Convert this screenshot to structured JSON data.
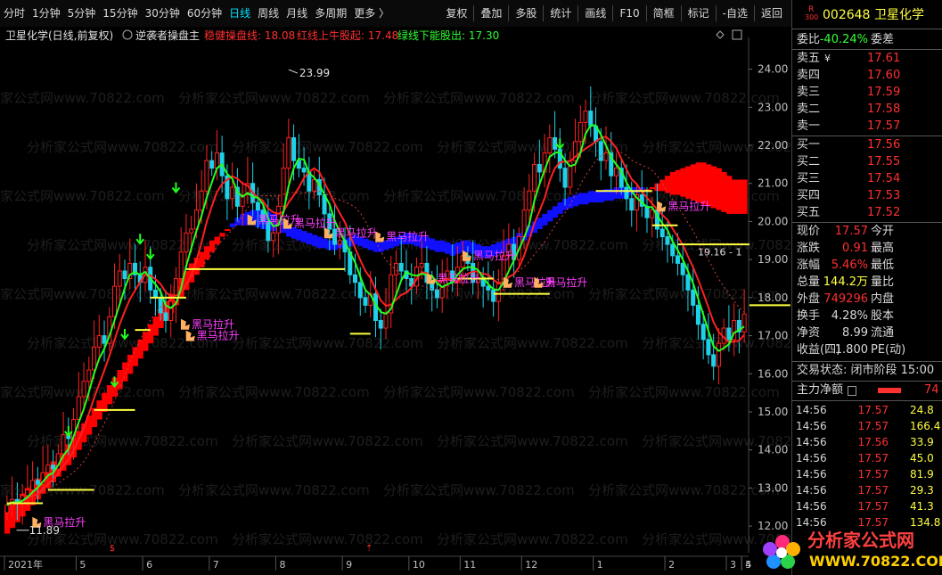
{
  "toolbar": {
    "left": [
      "分时",
      "1分钟",
      "5分钟",
      "15分钟",
      "30分钟",
      "60分钟",
      "日线",
      "周线",
      "月线",
      "多周期",
      "更多 〉"
    ],
    "active_index": 6,
    "right": [
      "复权",
      "叠加",
      "多股",
      "统计",
      "画线",
      "F10",
      "简框",
      "标记",
      "-自选",
      "返回"
    ]
  },
  "header": {
    "name": "卫星化学(日线,前复权)",
    "indicator": "逆袭者操盘主",
    "l1": "稳健操盘线: 18.08",
    "l2": "红线上牛股起: 17.48",
    "l3": "绿线下能股出: 17.30"
  },
  "chart_data": {
    "type": "candlestick",
    "ylim": [
      11.3,
      24.6
    ],
    "yticks": [
      "24.00",
      "23.00",
      "22.00",
      "21.00",
      "20.00",
      "19.00",
      "18.00",
      "17.00",
      "16.00",
      "15.00",
      "14.00",
      "13.00",
      "12.00"
    ],
    "xticks": [
      "2021年",
      "5",
      "6",
      "7",
      "8",
      "9",
      "10",
      "11",
      "12",
      "1",
      "2",
      "3",
      "4",
      "5"
    ],
    "annotations": {
      "high": "23.99",
      "low": "11.89",
      "right_price": "19.16 - 1"
    },
    "signal_label": "黑马拉升",
    "watermark": "分析家公式网www.70822.com",
    "close": [
      12.55,
      12.7,
      12.6,
      12.8,
      12.95,
      13.2,
      13.1,
      13.4,
      13.6,
      13.5,
      13.9,
      14.4,
      14.3,
      14.8,
      15.4,
      15.8,
      16.1,
      16.7,
      17.0,
      16.8,
      17.5,
      18.3,
      18.7,
      18.5,
      18.9,
      18.6,
      18.4,
      18.8,
      18.2,
      18.0,
      17.6,
      17.4,
      17.9,
      18.5,
      19.2,
      19.7,
      19.8,
      20.3,
      20.8,
      21.6,
      21.4,
      21.8,
      21.2,
      20.6,
      20.9,
      20.4,
      20.7,
      21.0,
      20.5,
      20.3,
      20.0,
      19.5,
      19.7,
      20.4,
      21.4,
      22.2,
      21.6,
      21.4,
      21.3,
      20.8,
      21.1,
      20.7,
      20.2,
      19.8,
      19.4,
      19.5,
      19.2,
      18.6,
      18.4,
      18.0,
      17.8,
      18.1,
      17.4,
      17.2,
      17.6,
      18.6,
      18.9,
      18.7,
      18.5,
      18.3,
      18.8,
      18.9,
      18.4,
      18.2,
      18.0,
      18.5,
      18.7,
      18.4,
      18.8,
      19.1,
      18.9,
      18.4,
      18.5,
      18.3,
      18.2,
      17.9,
      18.4,
      19.1,
      19.4,
      19.0,
      19.6,
      20.3,
      20.8,
      21.5,
      21.3,
      21.8,
      22.2,
      21.9,
      21.4,
      20.9,
      21.6,
      22.1,
      22.6,
      22.9,
      22.5,
      22.1,
      21.6,
      21.8,
      21.2,
      21.4,
      20.9,
      20.6,
      20.3,
      20.7,
      20.4,
      20.1,
      20.3,
      19.8,
      19.6,
      19.4,
      19.1,
      18.9,
      18.6,
      18.2,
      17.8,
      17.3,
      16.9,
      16.5,
      16.2,
      16.8,
      17.2,
      16.9,
      17.4,
      17.1,
      17.57
    ],
    "signals": [
      {
        "i": 6,
        "price": 12.1
      },
      {
        "i": 35,
        "price": 17.3
      },
      {
        "i": 36,
        "price": 17.0
      },
      {
        "i": 48,
        "price": 20.05
      },
      {
        "i": 55,
        "price": 19.95
      },
      {
        "i": 63,
        "price": 19.7
      },
      {
        "i": 73,
        "price": 19.6
      },
      {
        "i": 83,
        "price": 18.5
      },
      {
        "i": 90,
        "price": 19.1
      },
      {
        "i": 98,
        "price": 18.4
      },
      {
        "i": 104,
        "price": 18.4
      },
      {
        "i": 128,
        "price": 20.4
      }
    ],
    "support_lines": [
      {
        "i0": 0,
        "i1": 7,
        "price": 12.6
      },
      {
        "i0": 8,
        "i1": 17,
        "price": 12.95
      },
      {
        "i0": 17,
        "i1": 25,
        "price": 15.05
      },
      {
        "i0": 25,
        "i1": 28,
        "price": 17.15
      },
      {
        "i0": 28,
        "i1": 35,
        "price": 18.0
      },
      {
        "i0": 35,
        "i1": 66,
        "price": 18.75
      },
      {
        "i0": 67,
        "i1": 71,
        "price": 17.05
      },
      {
        "i0": 88,
        "i1": 95,
        "price": 18.5
      },
      {
        "i0": 95,
        "i1": 106,
        "price": 18.1
      },
      {
        "i0": 115,
        "i1": 126,
        "price": 20.8
      },
      {
        "i0": 126,
        "i1": 131,
        "price": 19.9
      },
      {
        "i0": 131,
        "i1": 145,
        "price": 19.4
      },
      {
        "i0": 145,
        "i1": 153,
        "price": 17.8
      }
    ],
    "down_arrows": [
      {
        "i": 12,
        "price": 14.3
      },
      {
        "i": 21,
        "price": 15.6
      },
      {
        "i": 23,
        "price": 16.85
      },
      {
        "i": 26,
        "price": 19.35
      },
      {
        "i": 28,
        "price": 18.95
      },
      {
        "i": 33,
        "price": 20.7
      },
      {
        "i": 108,
        "price": 21.85
      }
    ],
    "band_top": [
      11.8,
      11.95,
      12.1,
      12.25,
      12.4,
      12.55,
      12.7,
      12.85,
      13.0,
      13.15,
      13.3,
      13.45,
      13.6,
      13.8,
      14.0,
      14.2,
      14.4,
      14.6,
      14.8,
      15.0,
      15.2,
      15.4,
      15.6,
      15.8,
      16.0,
      16.2,
      16.4,
      16.6,
      16.8,
      17.0,
      17.2,
      17.4,
      17.6,
      17.8,
      18.0,
      18.2,
      18.4,
      18.6,
      18.8,
      19.0,
      19.2,
      19.4,
      19.6,
      19.8,
      19.95,
      20.1,
      20.2,
      20.25,
      20.3,
      20.3,
      20.3,
      20.25,
      20.2,
      20.1,
      20.0,
      19.9,
      19.85,
      19.8,
      19.75,
      19.7,
      19.65,
      19.6,
      19.55,
      19.5,
      19.45,
      19.5,
      19.55,
      19.6,
      19.65,
      19.6,
      19.55,
      19.5,
      19.45,
      19.45,
      19.5,
      19.55,
      19.6,
      19.65,
      19.7,
      19.7,
      19.65,
      19.6,
      19.6,
      19.55,
      19.5,
      19.5,
      19.45,
      19.4,
      19.45,
      19.5,
      19.5,
      19.45,
      19.4,
      19.35,
      19.35,
      19.4,
      19.45,
      19.5,
      19.55,
      19.6,
      19.7,
      19.8,
      19.9,
      20.0,
      20.1,
      20.2,
      20.3,
      20.4,
      20.5,
      20.6,
      20.65,
      20.7,
      20.75,
      20.75,
      20.8,
      20.8,
      20.8,
      20.85,
      20.85,
      20.9,
      20.9,
      20.9,
      20.9,
      20.9,
      20.9,
      20.85,
      20.85,
      20.8,
      20.8,
      20.75,
      20.7,
      20.7,
      20.65,
      20.6,
      20.55,
      20.5,
      20.45,
      20.4,
      20.35,
      20.3,
      20.25,
      20.2,
      20.2
    ],
    "band_bot": [
      12.5,
      12.6,
      12.7,
      12.85,
      13.0,
      13.1,
      13.25,
      13.4,
      13.55,
      13.7,
      13.85,
      14.0,
      14.15,
      14.3,
      14.5,
      14.7,
      14.9,
      15.1,
      15.3,
      15.5,
      15.7,
      15.9,
      16.1,
      16.3,
      16.5,
      16.7,
      16.9,
      17.1,
      17.3,
      17.5,
      17.7,
      17.9,
      18.1,
      18.3,
      18.5,
      18.7,
      18.9,
      19.05,
      19.2,
      19.35,
      19.5,
      19.6,
      19.7,
      19.8,
      19.85,
      19.9,
      19.9,
      19.9,
      19.9,
      19.85,
      19.8,
      19.8,
      19.75,
      19.7,
      19.7,
      19.6,
      19.55,
      19.5,
      19.45,
      19.4,
      19.35,
      19.3,
      19.3,
      19.25,
      19.25,
      19.3,
      19.35,
      19.35,
      19.4,
      19.35,
      19.3,
      19.25,
      19.2,
      19.2,
      19.25,
      19.3,
      19.35,
      19.4,
      19.4,
      19.4,
      19.35,
      19.3,
      19.3,
      19.25,
      19.2,
      19.2,
      19.15,
      19.1,
      19.15,
      19.2,
      19.2,
      19.15,
      19.1,
      19.05,
      19.05,
      19.1,
      19.15,
      19.2,
      19.25,
      19.3,
      19.4,
      19.5,
      19.6,
      19.7,
      19.8,
      19.9,
      20.0,
      20.1,
      20.2,
      20.3,
      20.35,
      20.4,
      20.45,
      20.45,
      20.5,
      20.5,
      20.5,
      20.55,
      20.55,
      20.6,
      20.6,
      20.65,
      20.7,
      20.75,
      20.8,
      20.85,
      20.9,
      21.0,
      21.1,
      21.2,
      21.3,
      21.35,
      21.4,
      21.45,
      21.5,
      21.55,
      21.55,
      21.5,
      21.45,
      21.4,
      21.3,
      21.2,
      21.1
    ]
  },
  "quote": {
    "code": "002648",
    "name": "卫星化学",
    "r_badge": "R",
    "r_sub": "300",
    "wei_bi_label": "委比",
    "wei_bi": "-40.24%",
    "wei_cha_label": "委差",
    "sell": [
      {
        "label": "卖五",
        "mark": "¥",
        "price": "17.61"
      },
      {
        "label": "卖四",
        "mark": "",
        "price": "17.60"
      },
      {
        "label": "卖三",
        "mark": "",
        "price": "17.59"
      },
      {
        "label": "卖二",
        "mark": "",
        "price": "17.58"
      },
      {
        "label": "卖一",
        "mark": "",
        "price": "17.57"
      }
    ],
    "buy": [
      {
        "label": "买一",
        "price": "17.56"
      },
      {
        "label": "买二",
        "price": "17.55"
      },
      {
        "label": "买三",
        "price": "17.54"
      },
      {
        "label": "买四",
        "price": "17.53"
      },
      {
        "label": "买五",
        "price": "17.52"
      }
    ],
    "stats": [
      {
        "l1": "现价",
        "v": "17.57",
        "l2": "今开",
        "cls": "red"
      },
      {
        "l1": "涨跌",
        "v": "0.91",
        "l2": "最高",
        "cls": "red"
      },
      {
        "l1": "涨幅",
        "v": "5.46%",
        "l2": "最低",
        "cls": "red"
      },
      {
        "l1": "总量",
        "v": "144.2万",
        "l2": "量比",
        "cls": "yellow"
      },
      {
        "l1": "外盘",
        "v": "749296",
        "l2": "内盘",
        "cls": "red"
      },
      {
        "l1": "换手",
        "v": "4.28%",
        "l2": "股本",
        "cls": "plain"
      },
      {
        "l1": "净资",
        "v": "8.99",
        "l2": "流通",
        "cls": "plain"
      },
      {
        "l1": "收益(四)",
        "v": "1.800",
        "l2": "PE(动)",
        "cls": "plain"
      }
    ],
    "status": "交易状态: 闭市阶段 15:00",
    "main_flow_label": "主力净额",
    "main_flow_value": "74",
    "ticks": [
      {
        "t": "14:56",
        "p": "17.57",
        "v": "24.8",
        "vc": "yellow"
      },
      {
        "t": "14:56",
        "p": "17.57",
        "v": "166.4",
        "vc": "magenta"
      },
      {
        "t": "14:56",
        "p": "17.56",
        "v": "33.9",
        "vc": "yellow"
      },
      {
        "t": "14:56",
        "p": "17.57",
        "v": "45.0",
        "vc": "yellow"
      },
      {
        "t": "14:56",
        "p": "17.57",
        "v": "81.9",
        "vc": "yellow"
      },
      {
        "t": "14:56",
        "p": "17.57",
        "v": "29.3",
        "vc": "yellow"
      },
      {
        "t": "14:56",
        "p": "17.57",
        "v": "41.3",
        "vc": "yellow"
      },
      {
        "t": "14:56",
        "p": "17.57",
        "v": "134.8",
        "vc": "magenta"
      }
    ]
  },
  "logo": {
    "title": "分析家公式网",
    "url": "WWW.70822.COM"
  },
  "colors": {
    "up": "#ff2020",
    "down": "#1ed0e8",
    "band_up": "#ff0000",
    "band_dn": "#1010ff",
    "ma_red": "#ff2020",
    "ma_green": "#22ff22",
    "support": "#ffff40",
    "label": "#ff40ff"
  }
}
